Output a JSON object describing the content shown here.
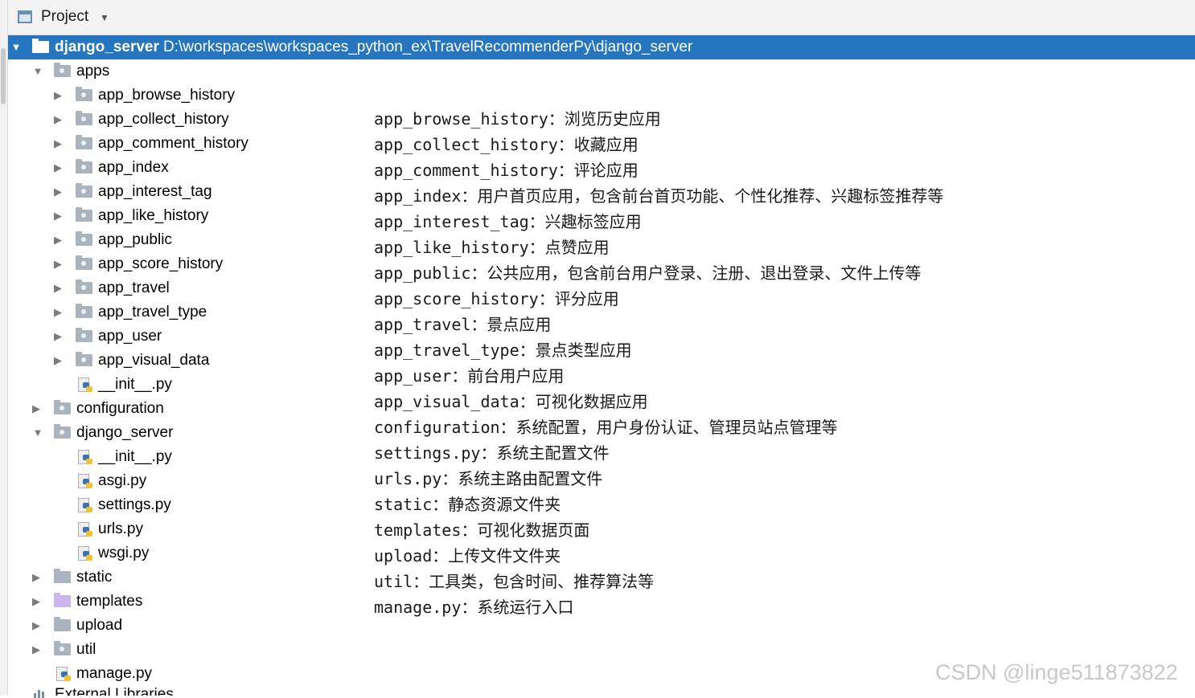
{
  "window": {
    "title": "Project"
  },
  "root": {
    "label": "django_server",
    "path": "D:\\workspaces\\workspaces_python_ex\\TravelRecommenderPy\\django_server"
  },
  "apps_folder": "apps",
  "apps_children": [
    "app_browse_history",
    "app_collect_history",
    "app_comment_history",
    "app_index",
    "app_interest_tag",
    "app_like_history",
    "app_public",
    "app_score_history",
    "app_travel",
    "app_travel_type",
    "app_user",
    "app_visual_data"
  ],
  "apps_init": "__init__.py",
  "configuration": "configuration",
  "django_server_pkg": {
    "label": "django_server",
    "files": [
      "__init__.py",
      "asgi.py",
      "settings.py",
      "urls.py",
      "wsgi.py"
    ]
  },
  "static": "static",
  "templates": "templates",
  "upload": "upload",
  "util": "util",
  "manage": "manage.py",
  "external_libraries": "External Libraries",
  "descriptions": [
    "app_browse_history：浏览历史应用",
    "app_collect_history：收藏应用",
    "app_comment_history：评论应用",
    "app_index：用户首页应用，包含前台首页功能、个性化推荐、兴趣标签推荐等",
    "app_interest_tag：兴趣标签应用",
    "app_like_history：点赞应用",
    "app_public：公共应用，包含前台用户登录、注册、退出登录、文件上传等",
    "app_score_history：评分应用",
    "app_travel：景点应用",
    "app_travel_type：景点类型应用",
    "app_user：前台用户应用",
    "app_visual_data：可视化数据应用",
    "configuration：系统配置，用户身份认证、管理员站点管理等",
    "settings.py：系统主配置文件",
    "urls.py：系统主路由配置文件",
    "static：静态资源文件夹",
    "templates：可视化数据页面",
    "upload：上传文件文件夹",
    "util：工具类，包含时间、推荐算法等",
    "manage.py：系统运行入口"
  ],
  "watermark": "CSDN @linge511873822"
}
